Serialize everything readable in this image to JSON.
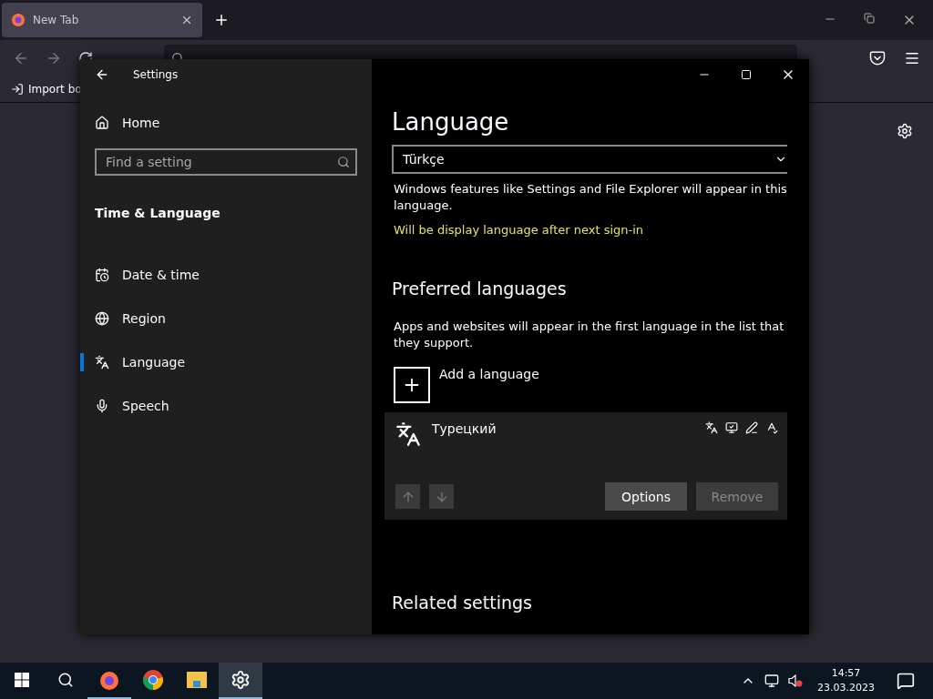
{
  "browser": {
    "tab": {
      "title": "New Tab",
      "selected": true
    },
    "bookmark": "Import bo"
  },
  "settings": {
    "title": "Settings",
    "home": "Home",
    "search": {
      "placeholder": "Find a setting"
    },
    "section": "Time & Language",
    "nav": [
      {
        "label": "Date & time",
        "kind": "calendar",
        "selected": false
      },
      {
        "label": "Region",
        "kind": "globe",
        "selected": false
      },
      {
        "label": "Language",
        "kind": "language",
        "selected": true
      },
      {
        "label": "Speech",
        "kind": "mic",
        "selected": false
      }
    ],
    "heading": "Language",
    "display_language": {
      "value": "Türkçe"
    },
    "display_description": "Windows features like Settings and File Explorer will appear in this language.",
    "display_note": "Will be display language after next sign-in",
    "preferred_heading": "Preferred languages",
    "preferred_description": "Apps and websites will appear in the first language in the list that they support.",
    "add_language": "Add a language",
    "languages": [
      {
        "name": "Турецкий",
        "selected": true,
        "move_up_disabled": true,
        "move_down_disabled": true,
        "buttons": [
          {
            "label": "Options",
            "disabled": false
          },
          {
            "label": "Remove",
            "disabled": true
          }
        ]
      }
    ],
    "related_heading": "Related settings"
  },
  "taskbar": {
    "apps": [
      {
        "kind": "firefox",
        "selected": false,
        "running": true
      },
      {
        "kind": "chrome",
        "selected": false,
        "running": false
      },
      {
        "kind": "folder",
        "selected": false,
        "running": false
      },
      {
        "kind": "settings",
        "selected": true,
        "running": true
      }
    ],
    "time": "14:57",
    "date": "23.03.2023"
  }
}
